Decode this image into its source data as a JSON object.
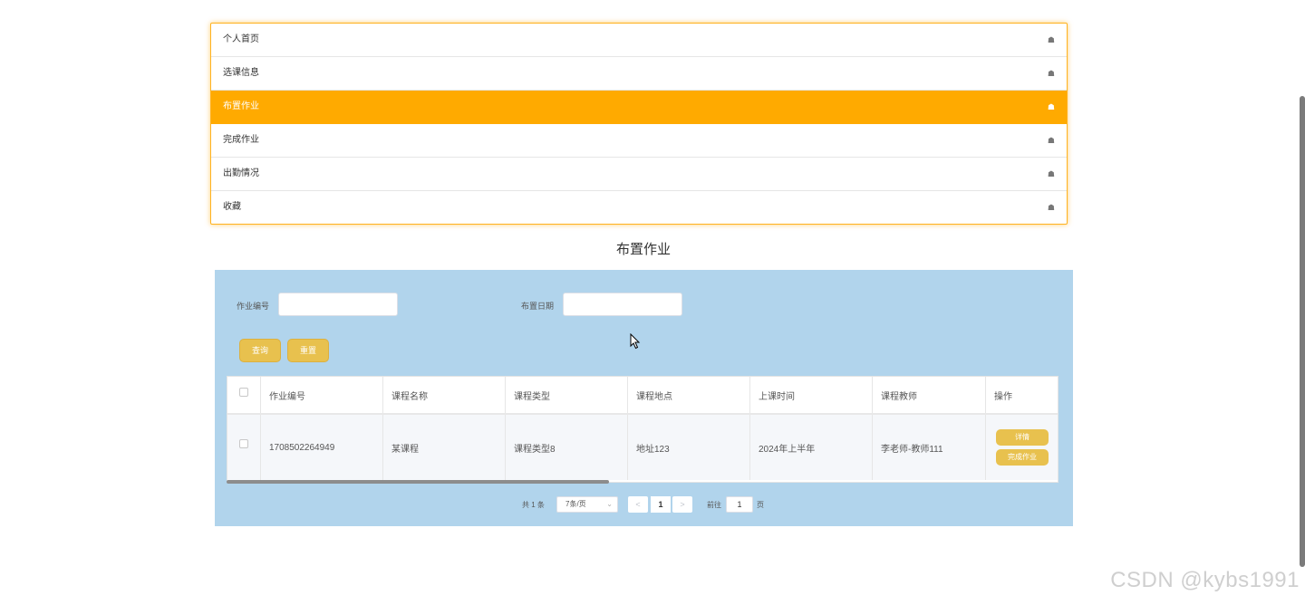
{
  "menu": {
    "items": [
      {
        "label": "个人首页",
        "icon": "home-icon"
      },
      {
        "label": "选课信息",
        "icon": "home-icon"
      },
      {
        "label": "布置作业",
        "icon": "home-icon",
        "active": true
      },
      {
        "label": "完成作业",
        "icon": "home-icon"
      },
      {
        "label": "出勤情况",
        "icon": "home-icon"
      },
      {
        "label": "收藏",
        "icon": "home-icon"
      }
    ]
  },
  "page": {
    "title": "布置作业"
  },
  "search": {
    "field1_label": "作业编号",
    "field1_value": "",
    "field2_label": "布置日期",
    "field2_value": "",
    "query_label": "查询",
    "reset_label": "重置"
  },
  "table": {
    "headers": [
      "作业编号",
      "课程名称",
      "课程类型",
      "课程地点",
      "上课时间",
      "课程教师",
      "操作"
    ],
    "rows": [
      {
        "cells": [
          "1708502264949",
          "某课程",
          "课程类型8",
          "地址123",
          "2024年上半年",
          "李老师-教师111"
        ],
        "actions": [
          "详情",
          "完成作业"
        ]
      }
    ]
  },
  "pagination": {
    "total": "共 1 条",
    "page_size": "7条/页",
    "current_page": "1",
    "goto_label": "前往",
    "goto_value": "1",
    "page_suffix": "页"
  },
  "watermark": "CSDN @kybs1991",
  "colors": {
    "accent": "#ffaa00",
    "panel": "#b1d4ec",
    "button": "#e8c14e"
  }
}
